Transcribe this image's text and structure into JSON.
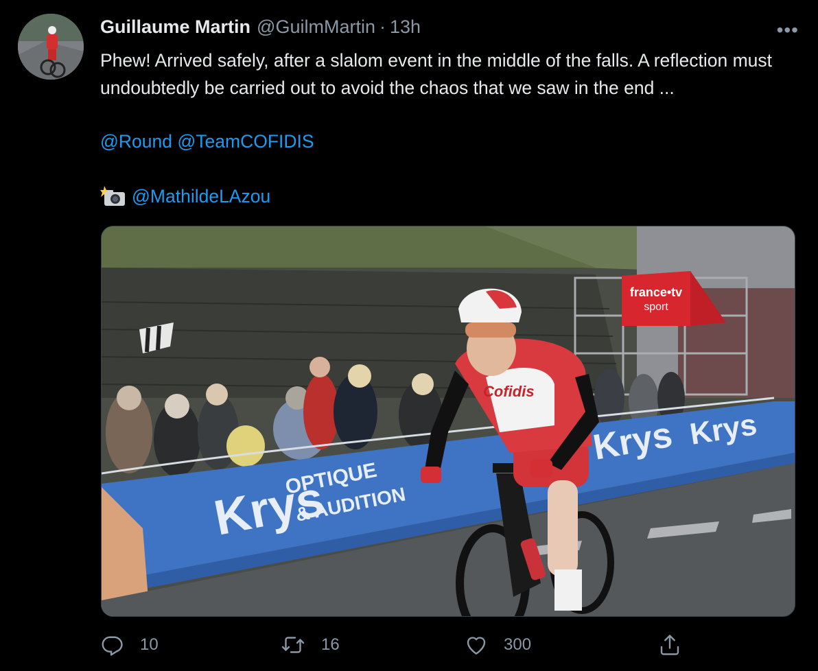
{
  "tweet": {
    "author_name": "Guillaume Martin",
    "author_handle": "@GuilmMartin",
    "separator": "·",
    "timestamp": "13h",
    "more_label": "•••",
    "text": "Phew! Arrived safely, after a slalom event in the middle of the falls. A reflection must undoubtedly be carried out to avoid the chaos that we saw in the end ...",
    "mention_1": "@Round",
    "mention_2": "@TeamCOFIDIS",
    "photo_credit": "@MathildeLAzou"
  },
  "media": {
    "sign_krys_1": "Krys",
    "sign_optique": "OPTIQUE",
    "sign_audition": "& AUDITION",
    "sign_krys_2": "Krys",
    "sign_krys_3": "Krys",
    "banner_brand": "france•tv",
    "banner_sub": "sport",
    "jersey_text": "Cofidis"
  },
  "actions": {
    "reply_count": "10",
    "retweet_count": "16",
    "like_count": "300"
  },
  "icons": {
    "reply": "reply-icon",
    "retweet": "retweet-icon",
    "like": "heart-icon",
    "share": "share-icon",
    "camera": "camera-flash-icon",
    "more": "more-icon"
  },
  "colors": {
    "background": "#000000",
    "text": "#e7e9ea",
    "secondary": "#8b98a5",
    "link": "#1d9bf0"
  }
}
